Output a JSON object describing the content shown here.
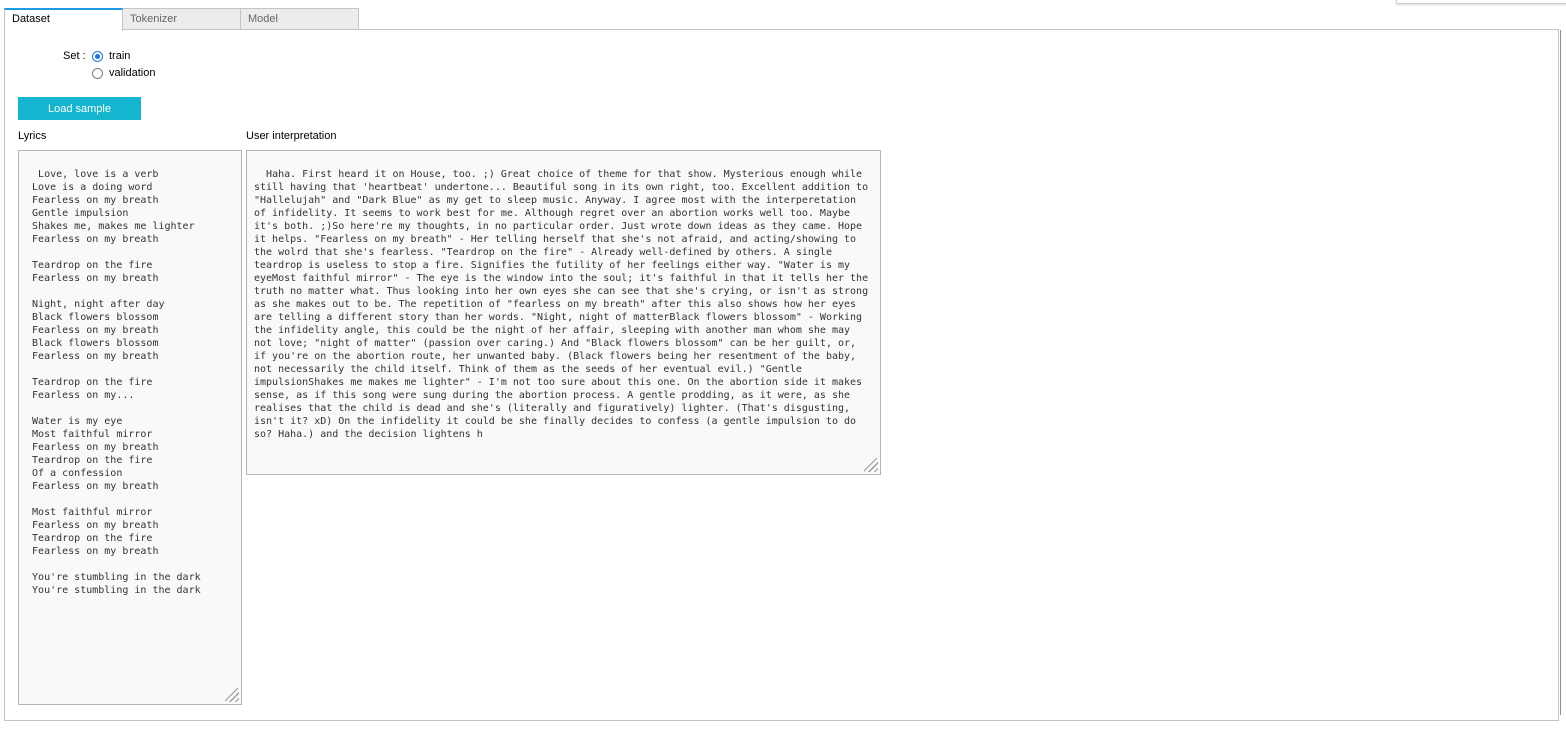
{
  "tabs": [
    {
      "label": "Dataset",
      "active": true
    },
    {
      "label": "Tokenizer",
      "active": false
    },
    {
      "label": "Model",
      "active": false
    }
  ],
  "set": {
    "label": "Set :",
    "options": [
      "train",
      "validation"
    ],
    "selected": "train"
  },
  "load_button": {
    "label": "Load sample",
    "color": "#14b5cf"
  },
  "lyrics": {
    "label": "Lyrics",
    "text": "Love, love is a verb\n Love is a doing word\n Fearless on my breath\n Gentle impulsion\n Shakes me, makes me lighter\n Fearless on my breath\n\n Teardrop on the fire\n Fearless on my breath\n\n Night, night after day\n Black flowers blossom\n Fearless on my breath\n Black flowers blossom\n Fearless on my breath\n\n Teardrop on the fire\n Fearless on my...\n\n Water is my eye\n Most faithful mirror\n Fearless on my breath\n Teardrop on the fire\n Of a confession\n Fearless on my breath\n\n Most faithful mirror\n Fearless on my breath\n Teardrop on the fire\n Fearless on my breath\n\n You're stumbling in the dark\n You're stumbling in the dark"
  },
  "interpretation": {
    "label": "User interpretation",
    "text": "Haha. First heard it on House, too. ;) Great choice of theme for that show. Mysterious enough while still having that 'heartbeat' undertone... Beautiful song in its own right, too. Excellent addition to \"Hallelujah\" and \"Dark Blue\" as my get to sleep music. Anyway. I agree most with the interperetation of infidelity. It seems to work best for me. Although regret over an abortion works well too. Maybe it's both. ;)So here're my thoughts, in no particular order. Just wrote down ideas as they came. Hope it helps. \"Fearless on my breath\" - Her telling herself that she's not afraid, and acting/showing to the wolrd that she's fearless. \"Teardrop on the fire\" - Already well-defined by others. A single teardrop is useless to stop a fire. Signifies the futility of her feelings either way. \"Water is my eyeMost faithful mirror\" - The eye is the window into the soul; it's faithful in that it tells her the truth no matter what. Thus looking into her own eyes she can see that she's crying, or isn't as strong as she makes out to be. The repetition of \"fearless on my breath\" after this also shows how her eyes are telling a different story than her words. \"Night, night of matterBlack flowers blossom\" - Working the infidelity angle, this could be the night of her affair, sleeping with another man whom she may not love; \"night of matter\" (passion over caring.) And \"Black flowers blossom\" can be her guilt, or, if you're on the abortion route, her unwanted baby. (Black flowers being her resentment of the baby, not necessarily the child itself. Think of them as the seeds of her eventual evil.) \"Gentle impulsionShakes me makes me lighter\" - I'm not too sure about this one. On the abortion side it makes sense, as if this song were sung during the abortion process. A gentle prodding, as it were, as she realises that the child is dead and she's (literally and figuratively) lighter. (That's disgusting, isn't it? xD) On the infidelity it could be she finally decides to confess (a gentle impulsion to do so? Haha.) and the decision lightens h"
  }
}
